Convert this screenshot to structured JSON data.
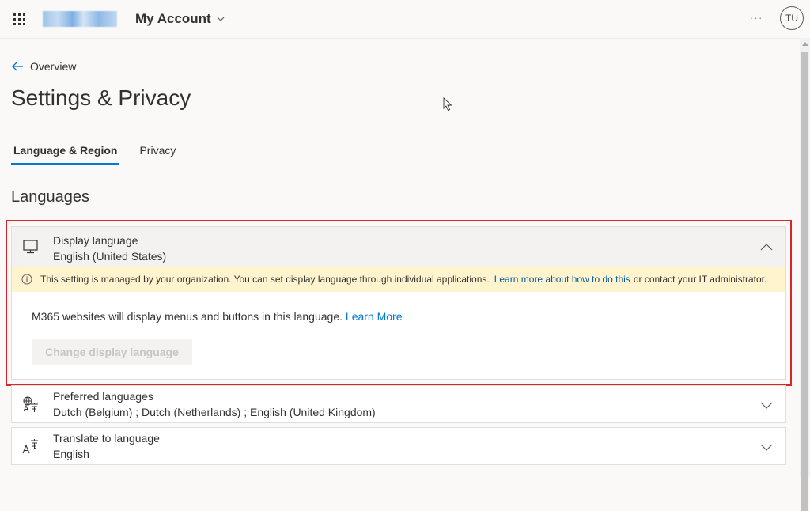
{
  "header": {
    "app_title": "My Account",
    "more_label": "···",
    "avatar_initials": "TU"
  },
  "nav": {
    "back_label": "Overview"
  },
  "page": {
    "title": "Settings & Privacy"
  },
  "tabs": [
    {
      "label": "Language & Region",
      "active": true
    },
    {
      "label": "Privacy",
      "active": false
    }
  ],
  "section": {
    "title": "Languages"
  },
  "display_language": {
    "title": "Display language",
    "value": "English (United States)",
    "notice_text": "This setting is managed by your organization. You can set display language through individual applications.",
    "notice_link": "Learn more about how to do this",
    "notice_tail": "or contact your IT administrator.",
    "description": "M365 websites will display menus and buttons in this language.",
    "description_link": "Learn More",
    "button_label": "Change display language"
  },
  "preferred_languages": {
    "title": "Preferred languages",
    "value": "Dutch (Belgium) ; Dutch (Netherlands) ; English (United Kingdom)"
  },
  "translate_language": {
    "title": "Translate to language",
    "value": "English"
  },
  "colors": {
    "accent": "#0078d4",
    "highlight_border": "#d92626",
    "notice_bg": "#fff4ce"
  }
}
